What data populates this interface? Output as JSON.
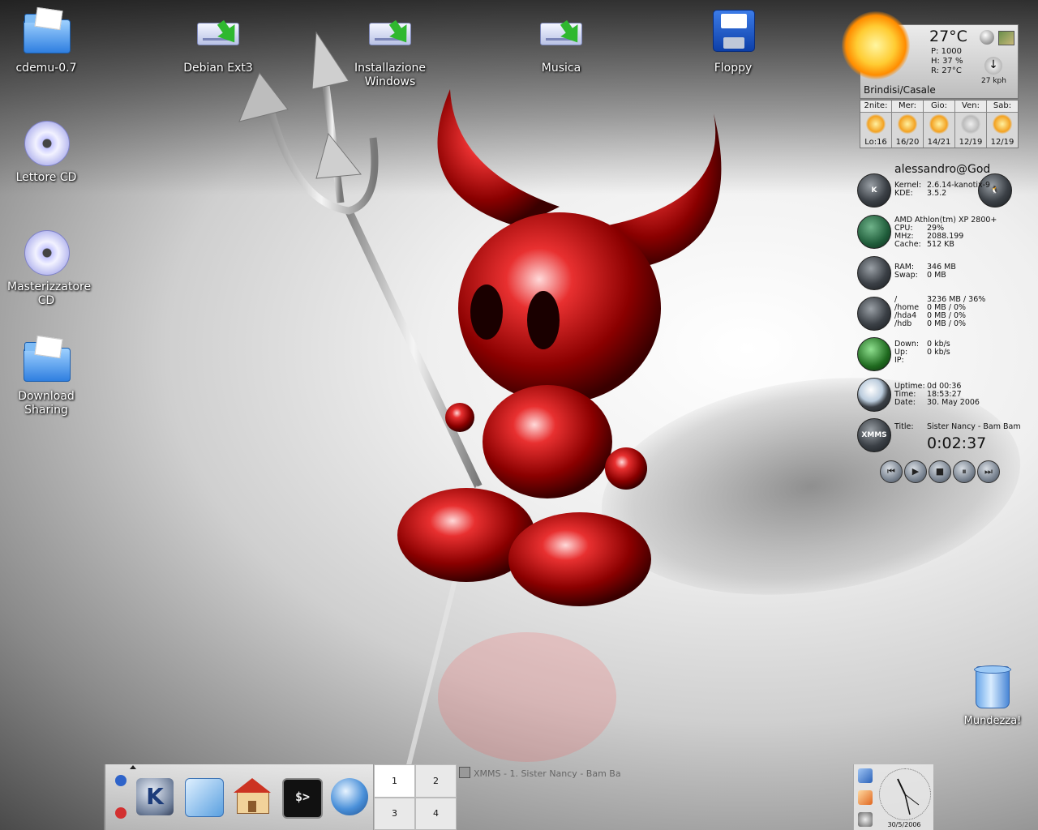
{
  "desktop": {
    "icons": [
      {
        "label": "cdemu-0.7"
      },
      {
        "label": "Debian Ext3"
      },
      {
        "label": "Installazione Windows"
      },
      {
        "label": "Musica"
      },
      {
        "label": "Floppy"
      },
      {
        "label": "Lettore CD"
      },
      {
        "label": "Masterizzatore CD"
      },
      {
        "label": "Download Sharing"
      }
    ],
    "trash_label": "Mundezza!"
  },
  "weather": {
    "temp": "27°C",
    "pressure": "P:  1000",
    "humidity": "H:  37 %",
    "real": "R:  27°C",
    "wind": "27 kph",
    "city": "Brindisi/Casale",
    "forecast": [
      {
        "day": "2nite:",
        "temps": "Lo:16"
      },
      {
        "day": "Mer:",
        "temps": "16/20"
      },
      {
        "day": "Gio:",
        "temps": "14/21"
      },
      {
        "day": "Ven:",
        "temps": "12/19"
      },
      {
        "day": "Sab:",
        "temps": "12/19"
      }
    ]
  },
  "system": {
    "user": "alessandro@God",
    "kernel_k": "Kernel:",
    "kernel_v": "2.6.14-kanotix-9",
    "kde_k": "KDE:",
    "kde_v": "3.5.2",
    "cpu_model": "AMD Athlon(tm) XP 2800+",
    "cpu_k": "CPU:",
    "cpu_v": "29%",
    "mhz_k": "MHz:",
    "mhz_v": "2088.199",
    "cache_k": "Cache:",
    "cache_v": "512 KB",
    "ram_k": "RAM:",
    "ram_v": "346 MB",
    "swap_k": "Swap:",
    "swap_v": "0 MB",
    "root_k": "/",
    "root_v": "3236 MB / 36%",
    "home_k": "/home",
    "home_v": "0 MB / 0%",
    "hda4_k": "/hda4",
    "hda4_v": "0 MB / 0%",
    "hdb_k": "/hdb",
    "hdb_v": "0 MB / 0%",
    "down_k": "Down:",
    "down_v": "0 kb/s",
    "up_k": "Up:",
    "up_v": "0 kb/s",
    "ip_k": "IP:",
    "uptime_k": "Uptime:",
    "uptime_v": "0d 00:36",
    "time_k": "Time:",
    "time_v": "18:53:27",
    "date_k": "Date:",
    "date_v": "30. May 2006",
    "xmms_label": "XMMS",
    "title_k": "Title:",
    "title_v": "Sister Nancy - Bam Bam",
    "elapsed": "0:02:37"
  },
  "taskbar": {
    "pager": [
      "1",
      "2",
      "3",
      "4"
    ],
    "task_title": "XMMS - 1. Sister Nancy - Bam Ba",
    "clock_date": "30/5/2006"
  },
  "colors": {
    "accent": "#cc1111",
    "panel": "#e9e9e9"
  }
}
